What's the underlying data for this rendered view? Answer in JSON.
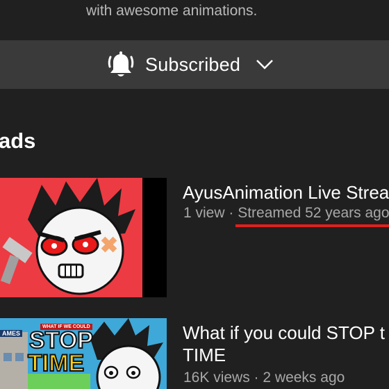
{
  "channel": {
    "description_tail": "with awesome animations."
  },
  "subscribe": {
    "label": "Subscribed",
    "bell_icon": "bell-icon",
    "chevron_icon": "chevron-down-icon"
  },
  "section": {
    "title": "ads"
  },
  "videos": [
    {
      "title": "AyusAnimation Live Strea",
      "views": "1 view",
      "separator": " · ",
      "age": "Streamed 52 years ago"
    },
    {
      "title": "What if you could STOP t TIME",
      "views": "16K views",
      "separator": " · ",
      "age": "2 weeks ago",
      "thumb_text_top": "WHAT IF WE COULD",
      "thumb_text_main1": "STOP",
      "thumb_text_main2": "TIME",
      "thumb_text_corner": "AMES"
    }
  ],
  "colors": {
    "background": "#202020",
    "subscribe_bar": "#3a3a3a",
    "highlight_underline": "#e0201c",
    "thumb1_bg": "#ec3b43"
  }
}
